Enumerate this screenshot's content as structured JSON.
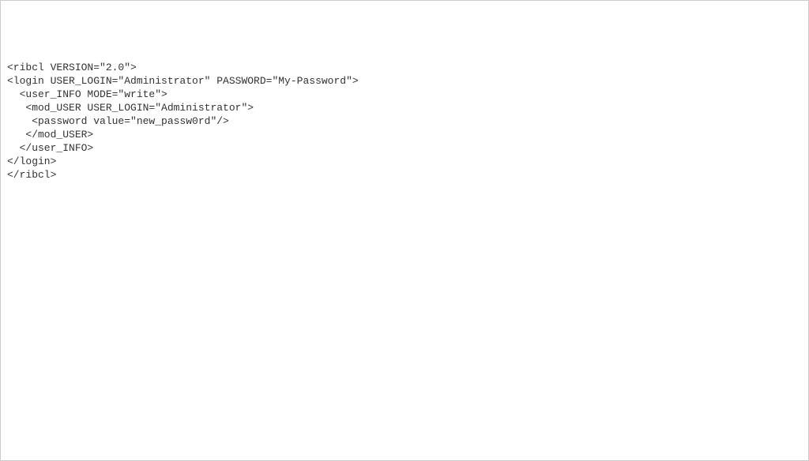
{
  "code": {
    "lines": [
      "<ribcl VERSION=\"2.0\">",
      "<login USER_LOGIN=\"Administrator\" PASSWORD=\"My-Password\">",
      "  <user_INFO MODE=\"write\">",
      "   <mod_USER USER_LOGIN=\"Administrator\">",
      "    <password value=\"new_passw0rd\"/>",
      "   </mod_USER>",
      "  </user_INFO>",
      "</login>",
      "</ribcl>"
    ]
  }
}
